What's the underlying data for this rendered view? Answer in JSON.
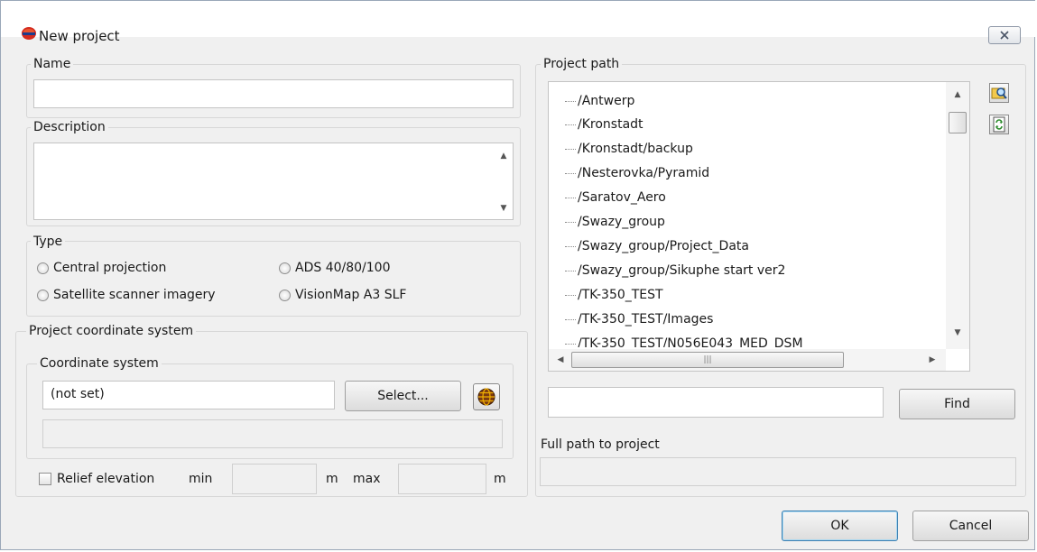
{
  "window": {
    "title": "New project"
  },
  "name_group": {
    "legend": "Name",
    "value": ""
  },
  "description_group": {
    "legend": "Description",
    "value": ""
  },
  "type_group": {
    "legend": "Type",
    "options": [
      "Central projection",
      "ADS 40/80/100",
      "Satellite scanner imagery",
      "VisionMap A3 SLF"
    ]
  },
  "coord_group": {
    "legend": "Project coordinate system",
    "inner_legend": "Coordinate system",
    "value": "(not set)",
    "select_label": "Select...",
    "icon": "globe-icon"
  },
  "relief": {
    "label": "Relief elevation",
    "min_label": "min",
    "unit": "m",
    "max_label": "max",
    "min_value": "",
    "max_value": ""
  },
  "project_path": {
    "legend": "Project path",
    "items": [
      "/Antwerp",
      "/Kronstadt",
      "/Kronstadt/backup",
      "/Nesterovka/Pyramid",
      "/Saratov_Aero",
      "/Swazy_group",
      "/Swazy_group/Project_Data",
      "/Swazy_group/Sikuphe start ver2",
      "/TK-350_TEST",
      "/TK-350_TEST/Images",
      "/TK-350_TEST/N056E043_MED_DSM"
    ],
    "search_value": "",
    "find_label": "Find",
    "icons": [
      "browse-folder-icon",
      "refresh-icon"
    ]
  },
  "full_path": {
    "label": "Full path to project",
    "value": ""
  },
  "footer": {
    "ok_label": "OK",
    "cancel_label": "Cancel"
  }
}
